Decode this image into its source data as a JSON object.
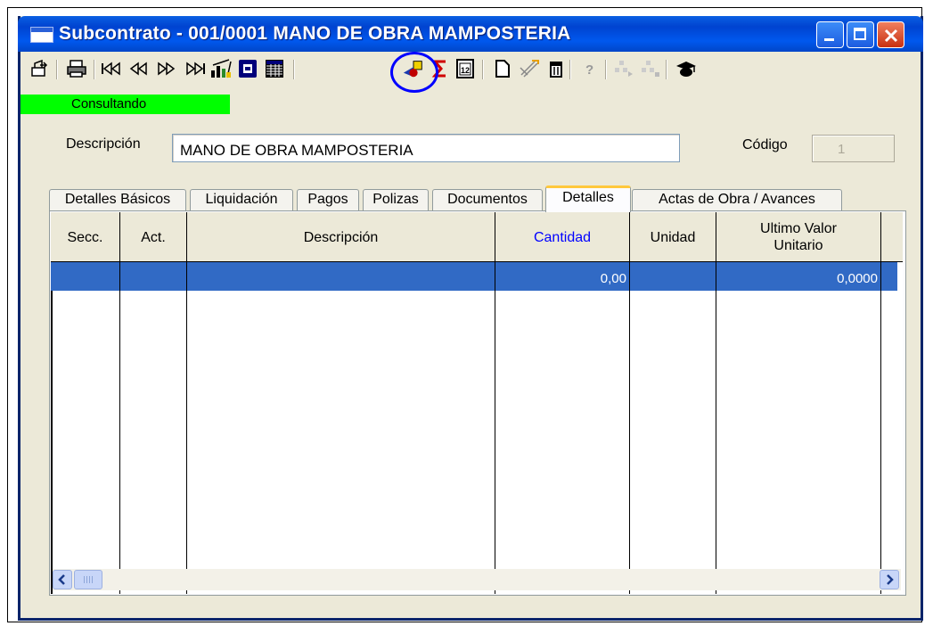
{
  "window": {
    "title": "Subcontrato - 001/0001 MANO DE OBRA MAMPOSTERIA"
  },
  "toolbar": {
    "icons": [
      "exit-icon",
      "print-icon",
      "first-record-icon",
      "previous-record-icon",
      "next-record-icon",
      "last-record-icon",
      "chart-icon",
      "form-view-icon",
      "grid-view-icon",
      "transfer-icon",
      "sum-icon",
      "calendar-icon",
      "new-record-icon",
      "edit-icon",
      "delete-icon",
      "help-icon",
      "tree-expand-icon",
      "tree-collapse-icon",
      "user-hat-icon"
    ]
  },
  "status": {
    "mode": "Consultando",
    "color": "#00ff00"
  },
  "form": {
    "description_label": "Descripción",
    "description_value": "MANO DE OBRA MAMPOSTERIA",
    "code_label": "Código",
    "code_value": "1"
  },
  "tabs": [
    {
      "label": "Detalles Básicos"
    },
    {
      "label": "Liquidación"
    },
    {
      "label": "Pagos"
    },
    {
      "label": "Polizas"
    },
    {
      "label": "Documentos"
    },
    {
      "label": "Detalles",
      "active": true
    },
    {
      "label": "Actas de Obra / Avances"
    }
  ],
  "grid": {
    "columns": [
      "Secc.",
      "Act.",
      "Descripción",
      "Cantidad",
      "Unidad",
      "Ultimo Valor Unitario"
    ],
    "rows": [
      {
        "secc": "",
        "act": "",
        "descripcion": "",
        "cantidad": "0,00",
        "unidad": "",
        "valor": "0,0000"
      }
    ],
    "selected_row_color": "#316ac5"
  },
  "colors": {
    "titlebar": "#0058ee",
    "highlight": "#0000ff"
  }
}
